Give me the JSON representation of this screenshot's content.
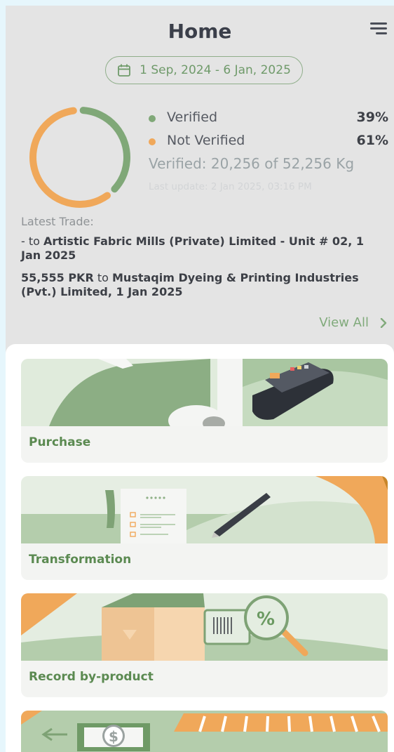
{
  "header": {
    "title": "Home",
    "menu_icon": "hamburger-menu-icon"
  },
  "date_range": {
    "text": "1 Sep, 2024 - 6 Jan, 2025",
    "icon": "calendar-icon"
  },
  "verification": {
    "items": [
      {
        "label": "Verified",
        "percent": "39%",
        "color": "#80a878"
      },
      {
        "label": "Not Verified",
        "percent": "61%",
        "color": "#f0a85a"
      }
    ],
    "verified_share": 0.39,
    "summary": "Verified: 20,256 of 52,256 Kg",
    "last_update": "Last update: 2 Jan 2025, 03:16 PM"
  },
  "latest_trades": {
    "label": "Latest Trade:",
    "trades": [
      {
        "prefix": "- to ",
        "party": "Artistic Fabric Mills (Private) Limited - Unit # 02, 1 Jan 2025"
      },
      {
        "amount": "55,555 PKR",
        "middle": " to ",
        "party": "Mustaqim Dyeing & Printing Industries (Pvt.) Limited, 1 Jan 2025"
      }
    ],
    "view_all": "View All"
  },
  "actions": [
    {
      "label": "Purchase"
    },
    {
      "label": "Transformation"
    },
    {
      "label": "Record by-product"
    }
  ],
  "colors": {
    "green": "#80a878",
    "orange": "#f0a85a",
    "accent_text": "#5b8a51"
  }
}
